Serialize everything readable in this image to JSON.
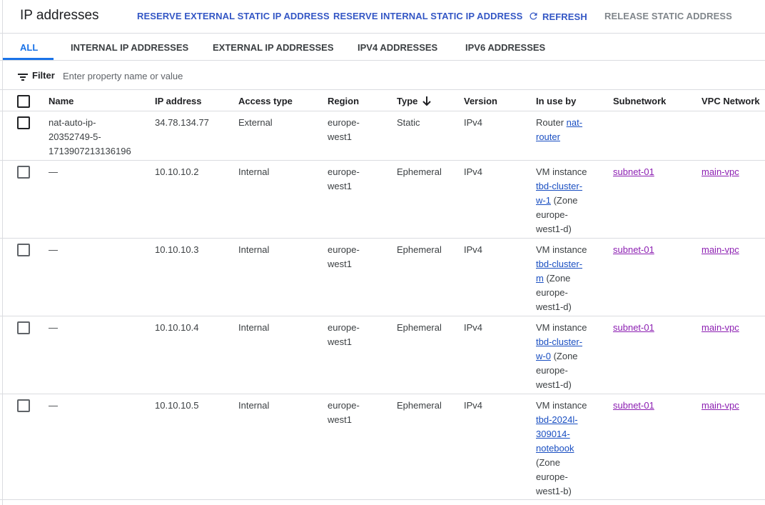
{
  "header": {
    "title": "IP addresses",
    "reserve_external": "RESERVE EXTERNAL STATIC IP ADDRESS",
    "reserve_internal": "RESERVE INTERNAL STATIC IP ADDRESS",
    "refresh": "REFRESH",
    "release": "RELEASE STATIC ADDRESS"
  },
  "tabs": [
    "ALL",
    "INTERNAL IP ADDRESSES",
    "EXTERNAL IP ADDRESSES",
    "IPV4 ADDRESSES",
    "IPV6 ADDRESSES"
  ],
  "filter": {
    "label": "Filter",
    "placeholder": "Enter property name or value"
  },
  "columns": {
    "name": "Name",
    "ip": "IP address",
    "access": "Access type",
    "region": "Region",
    "type": "Type",
    "version": "Version",
    "inuse": "In use by",
    "subnet": "Subnetwork",
    "vpc": "VPC Network"
  },
  "rows": [
    {
      "name": [
        "nat-auto-ip-",
        "20352749-5-",
        "1713907213136196"
      ],
      "ip": "34.78.134.77",
      "access": "External",
      "region": [
        "europe-",
        "west1"
      ],
      "type": "Static",
      "version": "IPv4",
      "inuse_prefix": "Router ",
      "inuse_link": [
        "nat-",
        "router"
      ],
      "inuse_suffix": [],
      "subnet": "",
      "vpc": ""
    },
    {
      "name": [
        "—"
      ],
      "ip": "10.10.10.2",
      "access": "Internal",
      "region": [
        "europe-",
        "west1"
      ],
      "type": "Ephemeral",
      "version": "IPv4",
      "inuse_prefix": "VM instance",
      "inuse_link": [
        "tbd-cluster-",
        "w-1"
      ],
      "inuse_suffix": [
        " (Zone",
        "europe-",
        "west1-d)"
      ],
      "subnet": "subnet-01",
      "vpc": "main-vpc"
    },
    {
      "name": [
        "—"
      ],
      "ip": "10.10.10.3",
      "access": "Internal",
      "region": [
        "europe-",
        "west1"
      ],
      "type": "Ephemeral",
      "version": "IPv4",
      "inuse_prefix": "VM instance",
      "inuse_link": [
        "tbd-cluster-",
        "m"
      ],
      "inuse_suffix": [
        " (Zone",
        "europe-",
        "west1-d)"
      ],
      "subnet": "subnet-01",
      "vpc": "main-vpc"
    },
    {
      "name": [
        "—"
      ],
      "ip": "10.10.10.4",
      "access": "Internal",
      "region": [
        "europe-",
        "west1"
      ],
      "type": "Ephemeral",
      "version": "IPv4",
      "inuse_prefix": "VM instance",
      "inuse_link": [
        "tbd-cluster-",
        "w-0"
      ],
      "inuse_suffix": [
        " (Zone",
        "europe-",
        "west1-d)"
      ],
      "subnet": "subnet-01",
      "vpc": "main-vpc"
    },
    {
      "name": [
        "—"
      ],
      "ip": "10.10.10.5",
      "access": "Internal",
      "region": [
        "europe-",
        "west1"
      ],
      "type": "Ephemeral",
      "version": "IPv4",
      "inuse_prefix": "VM instance",
      "inuse_link": [
        "tbd-2024l-",
        "309014-",
        "notebook"
      ],
      "inuse_suffix": [
        "(Zone",
        "europe-",
        "west1-b)"
      ],
      "subnet": "subnet-01",
      "vpc": "main-vpc"
    }
  ]
}
